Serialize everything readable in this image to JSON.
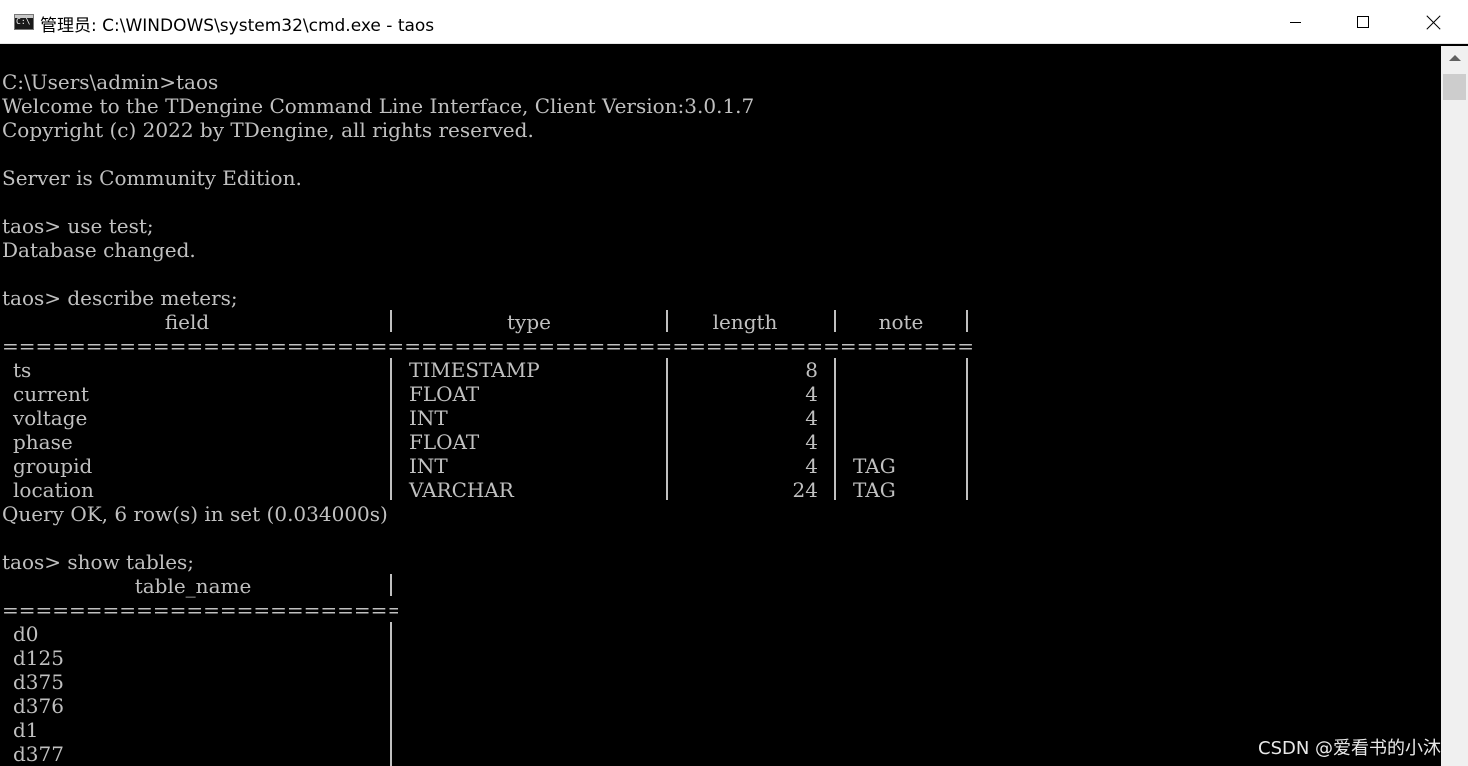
{
  "window": {
    "title": "管理员: C:\\WINDOWS\\system32\\cmd.exe - taos",
    "icon_text": "C:\\",
    "icon": "cmd-icon",
    "controls": {
      "minimize": "minimize-icon",
      "maximize": "maximize-icon",
      "close": "close-icon"
    }
  },
  "console": {
    "prompt_line": "C:\\Users\\admin>taos",
    "welcome": "Welcome to the TDengine Command Line Interface, Client Version:3.0.1.7",
    "copyright": "Copyright (c) 2022 by TDengine, all rights reserved.",
    "server": "Server is Community Edition.",
    "cmd_use": "taos> use test;",
    "db_changed": "Database changed.",
    "cmd_describe": "taos> describe meters;",
    "describe_headers": [
      "field",
      "type",
      "length",
      "note"
    ],
    "describe_separator": "==========================================================================================",
    "describe_rows": [
      {
        "field": "ts",
        "type": "TIMESTAMP",
        "length": "8",
        "note": ""
      },
      {
        "field": "current",
        "type": "FLOAT",
        "length": "4",
        "note": ""
      },
      {
        "field": "voltage",
        "type": "INT",
        "length": "4",
        "note": ""
      },
      {
        "field": "phase",
        "type": "FLOAT",
        "length": "4",
        "note": ""
      },
      {
        "field": "groupid",
        "type": "INT",
        "length": "4",
        "note": "TAG"
      },
      {
        "field": "location",
        "type": "VARCHAR",
        "length": "24",
        "note": "TAG"
      }
    ],
    "query_ok": "Query OK, 6 row(s) in set (0.034000s)",
    "cmd_show": "taos> show tables;",
    "tables_header": "table_name",
    "tables_separator": "====================================",
    "tables": [
      "d0",
      "d125",
      "d375",
      "d376",
      "d1",
      "d377"
    ]
  },
  "watermark": "CSDN @爱看书的小沐",
  "colors": {
    "console_bg": "#000000",
    "console_fg": "#c0c0c0",
    "titlebar_bg": "#ffffff",
    "scrollbar_bg": "#f0f0f0"
  }
}
